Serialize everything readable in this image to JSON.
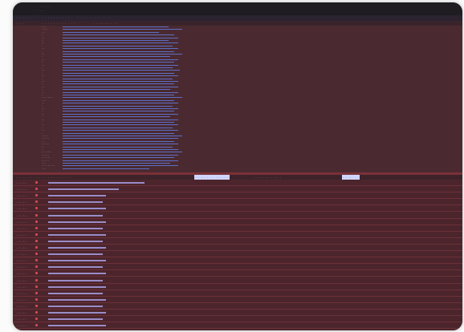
{
  "topbar": {
    "title_line1": "· · · · ·",
    "title_line2": "· · ·"
  },
  "pathbar": {
    "left": "· · · · · ·",
    "segment1": "· · · · · · · · ·",
    "segment2": "· · · · · · · · · · · ·"
  },
  "infobar": {
    "left": "· · ·",
    "segment1": "· · · · · · · · · · · ·",
    "segment2": "· · · · · · · · ·"
  },
  "tree": {
    "rows": [
      {
        "name": "···",
        "value": "·············",
        "fill": 0.55
      },
      {
        "name": "····",
        "value": "·············",
        "fill": 0.62
      },
      {
        "name": "··",
        "value": "·············",
        "fill": 0.5
      },
      {
        "name": "·",
        "value": "·············",
        "fill": 0.58
      },
      {
        "name": "··",
        "value": "·············",
        "fill": 0.6
      },
      {
        "name": "·",
        "value": "·············",
        "fill": 0.55
      },
      {
        "name": "··",
        "value": "·············",
        "fill": 0.6
      },
      {
        "name": "·",
        "value": "·············",
        "fill": 0.57
      },
      {
        "name": "··",
        "value": "·············",
        "fill": 0.6
      },
      {
        "name": "·",
        "value": "·············",
        "fill": 0.58
      },
      {
        "name": "··",
        "value": "·············",
        "fill": 0.62
      },
      {
        "name": "·",
        "value": "·············",
        "fill": 0.56
      },
      {
        "name": "··",
        "value": "·············",
        "fill": 0.6
      },
      {
        "name": "·",
        "value": "·············",
        "fill": 0.58
      },
      {
        "name": "··",
        "value": "·············",
        "fill": 0.6
      },
      {
        "name": "·",
        "value": "·············",
        "fill": 0.57
      },
      {
        "name": "··",
        "value": "·············",
        "fill": 0.61
      },
      {
        "name": "·",
        "value": "·············",
        "fill": 0.58
      },
      {
        "name": "··",
        "value": "·············",
        "fill": 0.6
      },
      {
        "name": "·",
        "value": "·············",
        "fill": 0.57
      },
      {
        "name": "··",
        "value": "·············",
        "fill": 0.6
      },
      {
        "name": "·",
        "value": "·············",
        "fill": 0.58
      },
      {
        "name": "··",
        "value": "·············",
        "fill": 0.6
      },
      {
        "name": "·",
        "value": "·············",
        "fill": 0.56
      },
      {
        "name": "··",
        "value": "·············",
        "fill": 0.6
      },
      {
        "name": "·",
        "value": "·············",
        "fill": 0.58
      },
      {
        "name": "········",
        "value": "·············",
        "fill": 0.62
      },
      {
        "name": "···",
        "value": "·············",
        "fill": 0.58
      },
      {
        "name": "··",
        "value": "·············",
        "fill": 0.6
      },
      {
        "name": "·",
        "value": "·············",
        "fill": 0.57
      },
      {
        "name": "··",
        "value": "·············",
        "fill": 0.6
      },
      {
        "name": "·",
        "value": "·············",
        "fill": 0.58
      },
      {
        "name": "··",
        "value": "·············",
        "fill": 0.6
      },
      {
        "name": "·",
        "value": "·············",
        "fill": 0.56
      },
      {
        "name": "··",
        "value": "·············",
        "fill": 0.6
      },
      {
        "name": "·",
        "value": "·············",
        "fill": 0.58
      },
      {
        "name": "··",
        "value": "·············",
        "fill": 0.6
      },
      {
        "name": "·",
        "value": "·············",
        "fill": 0.57
      },
      {
        "name": "··",
        "value": "·············",
        "fill": 0.6
      },
      {
        "name": "·",
        "value": "·············",
        "fill": 0.58
      },
      {
        "name": "····",
        "value": "·············",
        "fill": 0.62
      },
      {
        "name": "·····",
        "value": "·············",
        "fill": 0.6
      },
      {
        "name": "··",
        "value": "·············",
        "fill": 0.58
      },
      {
        "name": "·····",
        "value": "·············",
        "fill": 0.6
      },
      {
        "name": "··",
        "value": "·············",
        "fill": 0.57
      },
      {
        "name": "·",
        "value": "·············",
        "fill": 0.6
      },
      {
        "name": "·······",
        "value": "·············",
        "fill": 0.62
      },
      {
        "name": "·····",
        "value": "·············",
        "fill": 0.6
      },
      {
        "name": "······",
        "value": "·············",
        "fill": 0.58
      },
      {
        "name": "·····",
        "value": "·············",
        "fill": 0.6
      },
      {
        "name": "···",
        "value": "·············",
        "fill": 0.56
      },
      {
        "name": "·········",
        "value": "·············",
        "fill": 0.6
      },
      {
        "name": "···",
        "value": "·············",
        "fill": 0.45
      }
    ]
  },
  "status": {
    "left": "· · · · · · · · · · · · · · · · · · · ·",
    "highlight": "· · · · · · · · · · · ·",
    "mid": "· · · · · · · · · ·",
    "right": "· · · · · ·"
  },
  "log": {
    "rows": [
      {
        "time": "··:··:··",
        "msg": "···· ······· ········ ············",
        "fill": 0.3
      },
      {
        "time": "··:··:··",
        "msg": "···· ······· ········ ······",
        "fill": 0.22
      },
      {
        "time": "··:··:··",
        "msg": "···· ······· ········",
        "fill": 0.18
      },
      {
        "time": "··:··:··",
        "msg": "···· ······· ········",
        "fill": 0.17
      },
      {
        "time": "··:··:··",
        "msg": "···· ······· ········",
        "fill": 0.18
      },
      {
        "time": "··:··:··",
        "msg": "···· ······· ········",
        "fill": 0.17
      },
      {
        "time": "··:··:··",
        "msg": "···· ······· ········",
        "fill": 0.18
      },
      {
        "time": "··:··:··",
        "msg": "···· ······· ········",
        "fill": 0.17
      },
      {
        "time": "··:··:··",
        "msg": "···· ······· ········",
        "fill": 0.18
      },
      {
        "time": "··:··:··",
        "msg": "···· ······· ········",
        "fill": 0.17
      },
      {
        "time": "··:··:··",
        "msg": "···· ······· ········",
        "fill": 0.18
      },
      {
        "time": "··:··:··",
        "msg": "···· ······· ········",
        "fill": 0.17
      },
      {
        "time": "··:··:··",
        "msg": "···· ······· ········",
        "fill": 0.18
      },
      {
        "time": "··:··:··",
        "msg": "···· ······· ········",
        "fill": 0.17
      },
      {
        "time": "··:··:··",
        "msg": "···· ······· ········",
        "fill": 0.18
      },
      {
        "time": "··:··:··",
        "msg": "···· ······· ········",
        "fill": 0.17
      },
      {
        "time": "··:··:··",
        "msg": "···· ······· ········",
        "fill": 0.18
      },
      {
        "time": "··:··:··",
        "msg": "···· ······· ········",
        "fill": 0.17
      },
      {
        "time": "··:··:··",
        "msg": "···· ······· ········",
        "fill": 0.18
      },
      {
        "time": "··:··:··",
        "msg": "···· ······· ········",
        "fill": 0.17
      },
      {
        "time": "··:··:··",
        "msg": "···· ······· ········",
        "fill": 0.18
      },
      {
        "time": "··:··:··",
        "msg": "···· ······· ········",
        "fill": 0.17
      },
      {
        "time": "··:··:··",
        "msg": "···· ······· ········",
        "fill": 0.18
      }
    ]
  }
}
